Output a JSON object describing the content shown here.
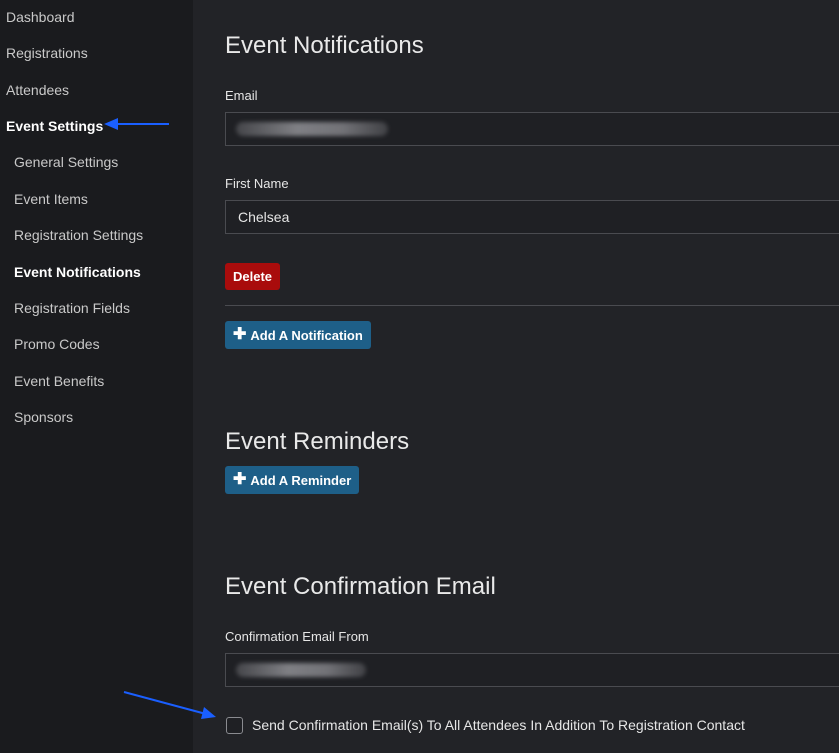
{
  "sidebar": {
    "items": [
      {
        "label": "Dashboard"
      },
      {
        "label": "Registrations"
      },
      {
        "label": "Attendees"
      },
      {
        "label": "Event Settings"
      },
      {
        "label": "General Settings"
      },
      {
        "label": "Event Items"
      },
      {
        "label": "Registration Settings"
      },
      {
        "label": "Event Notifications"
      },
      {
        "label": "Registration Fields"
      },
      {
        "label": "Promo Codes"
      },
      {
        "label": "Event Benefits"
      },
      {
        "label": "Sponsors"
      }
    ]
  },
  "notifications": {
    "title": "Event Notifications",
    "email_label": "Email",
    "first_name_label": "First Name",
    "first_name_value": "Chelsea",
    "delete_label": "Delete",
    "add_label": "Add A Notification"
  },
  "reminders": {
    "title": "Event Reminders",
    "add_label": "Add A Reminder"
  },
  "confirmation": {
    "title": "Event Confirmation Email",
    "from_label": "Confirmation Email From",
    "checkbox_label": "Send Confirmation Email(s) To All Attendees In Addition To Registration Contact"
  },
  "colors": {
    "danger": "#a90c0c",
    "primary": "#1e5f88",
    "annotation_arrow": "#1a5fff"
  }
}
